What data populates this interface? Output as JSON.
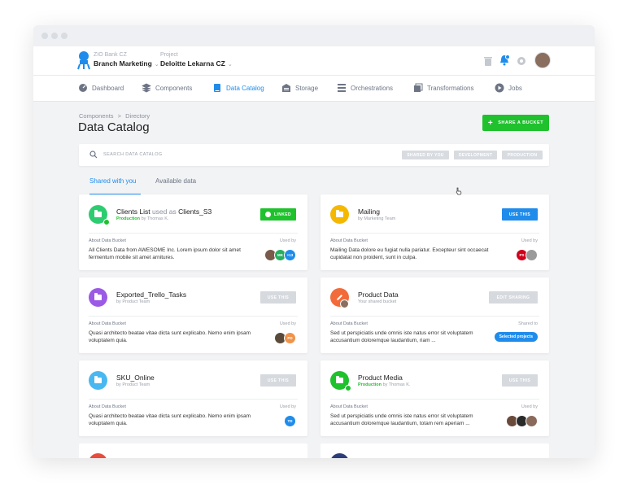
{
  "header": {
    "org_label": "ZIO Bank CZ",
    "org_name": "Branch Marketing",
    "project_label": "Project",
    "project_name": "Deloitte Lekarna CZ",
    "icons": [
      "trash-icon",
      "bell-icon",
      "gear-icon"
    ]
  },
  "nav": {
    "items": [
      {
        "label": "Dashboard",
        "icon": "dashboard-icon"
      },
      {
        "label": "Components",
        "icon": "components-icon"
      },
      {
        "label": "Data Catalog",
        "icon": "catalog-icon",
        "active": true
      },
      {
        "label": "Storage",
        "icon": "storage-icon"
      },
      {
        "label": "Orchestrations",
        "icon": "orchestrations-icon"
      },
      {
        "label": "Transformations",
        "icon": "transformations-icon"
      },
      {
        "label": "Jobs",
        "icon": "jobs-icon"
      }
    ]
  },
  "breadcrumb": {
    "parent": "Components",
    "separator": ">",
    "current": "Directory"
  },
  "page_title": "Data Catalog",
  "share_button": "SHARE A BUCKET",
  "search": {
    "placeholder": "SEARCH DATA CATALOG",
    "filters": [
      "SHARED BY YOU",
      "DEVELOPMENT",
      "PRODUCTION"
    ]
  },
  "tabs": [
    "Shared with you",
    "Available data"
  ],
  "cards": [
    {
      "title": "Clients List",
      "title_mid": "used as",
      "title_alias": "Clients_S3",
      "stage": "Production",
      "owner": "by Thomas K.",
      "icon_color": "#2ecc71",
      "button": "LINKED",
      "about": "About Data Bucket",
      "used_label": "Used by",
      "desc": "All Clients Data from AWESOME Inc. Lorem ipsum dolor sit amet fermentum mobile sit amet arnitures.",
      "avatars": [
        {
          "text": "",
          "color": "#7a5a4a"
        },
        {
          "text": "MK",
          "color": "#27ae60"
        },
        {
          "text": "+13",
          "color": "#1f8ceb"
        }
      ]
    },
    {
      "title": "Mailing",
      "owner": "by Marketing Team",
      "icon_color": "#f5b800",
      "button": "USE THIS",
      "about": "About Data Bucket",
      "used_label": "Used by",
      "desc": "Mailing Data dolore eu fugiat nulla pariatur. Excepteur sint occaecat cupidatat non proident, sunt in culpa.",
      "avatars": [
        {
          "text": "PS",
          "color": "#d0021b"
        },
        {
          "text": "",
          "color": "#9a9a9a"
        }
      ]
    },
    {
      "title": "Exported_Trello_Tasks",
      "owner": "by Product Team",
      "icon_color": "#9b59e6",
      "button": "USE THIS",
      "about": "About Data Bucket",
      "used_label": "Used by",
      "desc": "Quasi architecto beatae vitae dicta sunt explicabo. Nemo enim ipsam voluptatem quia.",
      "avatars": [
        {
          "text": "",
          "color": "#5a4a3a"
        },
        {
          "text": "PD",
          "color": "#f0934a"
        }
      ]
    },
    {
      "title": "Product Data",
      "owner": "Your shared bucket",
      "icon_color": "#f26b3a",
      "button": "EDIT SHARING",
      "about": "About Data Bucket",
      "used_label": "Shared to",
      "desc": "Sed ut perspiciatis unde omnis iste natus error sit voluptatem accusantium doloremque laudantium, riam ...",
      "pill": "Selected projects"
    },
    {
      "title": "SKU_Online",
      "owner": "by Product Team",
      "icon_color": "#4ab8f0",
      "button": "USE THIS",
      "about": "About Data Bucket",
      "used_label": "Used by",
      "desc": "Quasi architecto beatae vitae dicta sunt explicabo. Nemo enim ipsam voluptatem quia.",
      "avatars": [
        {
          "text": "TD",
          "color": "#1f8ceb"
        }
      ]
    },
    {
      "title": "Product Media",
      "stage": "Production",
      "owner": "by Thomas K.",
      "icon_color": "#1fc12d",
      "button": "USE THIS",
      "about": "About Data Bucket",
      "used_label": "Used by",
      "desc": "Sed ut perspiciatis unde omnis iste natus error sit voluptatem accusantium doloremque laudantium, totam rem aperiam ...",
      "avatars": [
        {
          "text": "",
          "color": "#6a4a3a"
        },
        {
          "text": "",
          "color": "#2a2a2a"
        },
        {
          "text": "",
          "color": "#8a6a5a"
        }
      ]
    }
  ],
  "colors": {
    "accent": "#1f8ceb",
    "success": "#1fc12d"
  }
}
